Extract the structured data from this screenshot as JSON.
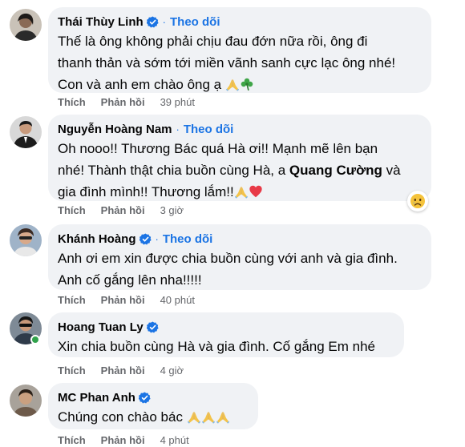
{
  "comments": [
    {
      "name": "Thái Thùy Linh",
      "follow": "Theo dõi",
      "text_lines": [
        "Thế là ông không phải chịu đau đớn nữa rồi, ông đi",
        "thanh thản và sớm tới miền vãnh sanh cực lạc ông nhé!",
        "Con và anh em chào ông ạ"
      ],
      "like": "Thích",
      "reply": "Phản hồi",
      "time": "39 phút"
    },
    {
      "name": "Nguyễn Hoàng Nam",
      "follow": "Theo dõi",
      "text_lines": [
        "Oh nooo!! Thương Bác quá Hà ơi!! Mạnh mẽ lên bạn",
        "nhé! Thành thật chia buồn cùng Hà, a",
        "Quang Cường",
        "và",
        "gia đình mình!! Thương lắm!!"
      ],
      "like": "Thích",
      "reply": "Phản hồi",
      "time": "3 giờ"
    },
    {
      "name": "Khánh Hoàng",
      "follow": "Theo dõi",
      "text_lines": [
        "Anh ơi em xin được chia buồn cùng với anh và gia đình.",
        "Anh cố gắng lên nha!!!!!"
      ],
      "like": "Thích",
      "reply": "Phản hồi",
      "time": "40 phút"
    },
    {
      "name": "Hoang Tuan Ly",
      "text_lines": [
        "Xin chia buồn cùng Hà và gia đình. Cố gắng Em nhé"
      ],
      "like": "Thích",
      "reply": "Phản hồi",
      "time": "4 giờ"
    },
    {
      "name": "MC Phan Anh",
      "text_lines": [
        "Chúng con chào bác"
      ],
      "like": "Thích",
      "reply": "Phản hồi",
      "time": "4 phút"
    }
  ],
  "colors": {
    "link": "#1b74e4",
    "bubble": "#f0f2f5",
    "meta": "#65676b",
    "online": "#31a24c"
  }
}
